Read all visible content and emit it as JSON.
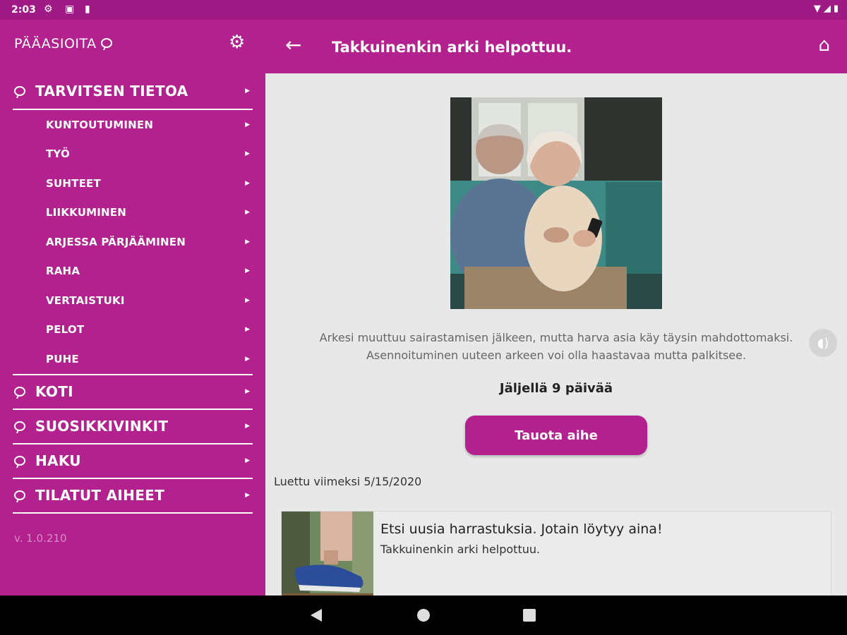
{
  "status_bar": {
    "time": "2:03",
    "left_icons": [
      "gear-icon",
      "image-icon",
      "sim-icon"
    ],
    "right_icons": [
      "wifi-icon",
      "signal-icon",
      "battery-icon"
    ]
  },
  "drawer": {
    "title": "PÄÄASIOITA",
    "items": [
      {
        "label": "TARVITSEN TIETOA",
        "subitems": [
          {
            "label": "KUNTOUTUMINEN"
          },
          {
            "label": "TYÖ"
          },
          {
            "label": "SUHTEET"
          },
          {
            "label": "LIIKKUMINEN"
          },
          {
            "label": "ARJESSA PÄRJÄÄMINEN"
          },
          {
            "label": "RAHA"
          },
          {
            "label": "VERTAISTUKI"
          },
          {
            "label": "PELOT"
          },
          {
            "label": "PUHE"
          }
        ]
      },
      {
        "label": "KOTI"
      },
      {
        "label": "SUOSIKKIVINKIT"
      },
      {
        "label": "HAKU"
      },
      {
        "label": "TILATUT AIHEET"
      }
    ],
    "version": "v. 1.0.210"
  },
  "appbar": {
    "title": "Takkuinenkin arki helpottuu."
  },
  "content": {
    "intro": "Arkesi muuttuu sairastamisen jälkeen, mutta harva asia käy täysin mahdottomaksi. Asennoituminen uuteen arkeen voi olla haastavaa mutta palkitsee.",
    "days_left": "Jäljellä 9 päivää",
    "pause_button": "Tauota aihe",
    "last_read": "Luettu viimeksi 5/15/2020",
    "card": {
      "title": "Etsi uusia harrastuksia. Jotain löytyy aina!",
      "subtitle": "Takkuinenkin arki helpottuu."
    }
  },
  "colors": {
    "brand": "#b3218f",
    "status_bar": "#a01a86",
    "background": "#e8e8e8"
  }
}
